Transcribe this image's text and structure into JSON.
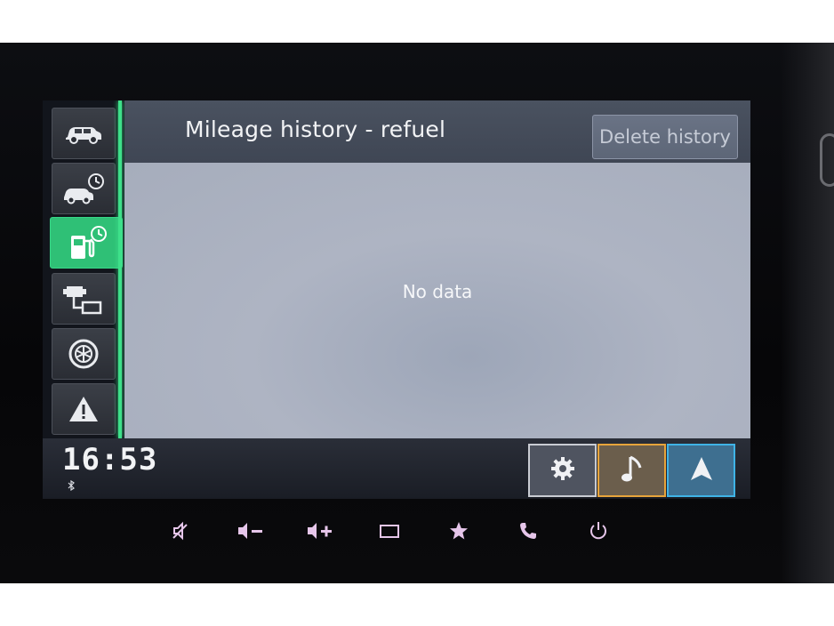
{
  "screen": {
    "title": "Mileage history - refuel",
    "delete_button": "Delete history",
    "empty_message": "No data"
  },
  "sidebar": {
    "items": [
      {
        "icon": "car-icon",
        "active": false
      },
      {
        "icon": "car-history-icon",
        "active": false
      },
      {
        "icon": "fuel-history-icon",
        "active": true
      },
      {
        "icon": "engine-transfer-icon",
        "active": false
      },
      {
        "icon": "tire-icon",
        "active": false
      },
      {
        "icon": "warning-icon",
        "active": false
      }
    ]
  },
  "status": {
    "clock": "16:53",
    "bluetooth_icon": "bluetooth-icon"
  },
  "quick_buttons": [
    {
      "icon": "gear-icon"
    },
    {
      "icon": "music-note-icon"
    },
    {
      "icon": "navigation-arrow-icon"
    }
  ],
  "hardware_buttons": [
    {
      "icon": "mute-icon"
    },
    {
      "icon": "volume-down-icon"
    },
    {
      "icon": "volume-up-icon"
    },
    {
      "icon": "screen-icon"
    },
    {
      "icon": "star-icon"
    },
    {
      "icon": "phone-icon"
    },
    {
      "icon": "power-icon"
    }
  ],
  "colors": {
    "accent_green": "#3ee08a",
    "media_orange": "#e7a43b",
    "nav_blue": "#3fb3e6",
    "header_bg": "#4a5260",
    "content_bg": "#aeb4c3"
  }
}
